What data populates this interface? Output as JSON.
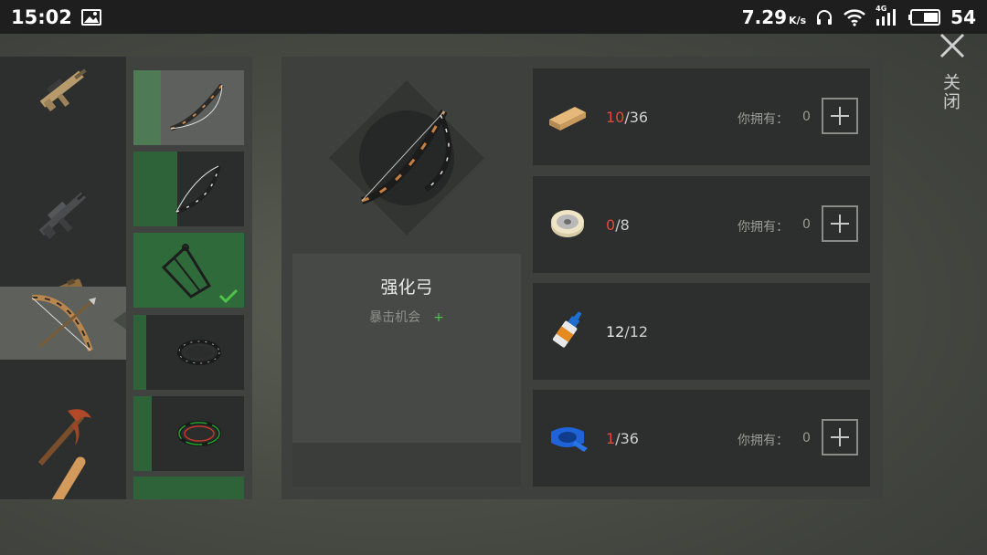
{
  "status_bar": {
    "time": "15:02",
    "net_speed": "7.29",
    "net_speed_unit": "K/s",
    "network_type": "4G",
    "battery": "54",
    "icons": [
      "gallery-icon",
      "headphones-icon",
      "wifi-icon",
      "signal-icon",
      "battery-icon"
    ]
  },
  "close": {
    "label": "关闭",
    "icon": "close-icon"
  },
  "categories": [
    {
      "id": "assault-rifle-1",
      "icon": "assault-rifle-icon",
      "selected": false
    },
    {
      "id": "assault-rifle-2",
      "icon": "rifle-icon",
      "selected": false
    },
    {
      "id": "pistol",
      "icon": "pistol-icon",
      "selected": false
    },
    {
      "id": "bow",
      "icon": "bow-icon",
      "selected": true
    },
    {
      "id": "pickaxe",
      "icon": "pickaxe-icon",
      "selected": false
    },
    {
      "id": "bat",
      "icon": "bat-icon",
      "selected": false
    }
  ],
  "variants": [
    {
      "id": "bow-1",
      "icon": "bow-icon",
      "crafted": false
    },
    {
      "id": "bow-2",
      "icon": "bow-icon",
      "crafted": false
    },
    {
      "id": "bow-3",
      "icon": "compound-bow-icon",
      "crafted": true
    },
    {
      "id": "bowstring-1",
      "icon": "bowstring-icon",
      "crafted": false
    },
    {
      "id": "bowstring-2",
      "icon": "bowstring-green-icon",
      "crafted": false
    },
    {
      "id": "variant-6",
      "icon": "",
      "crafted": false
    }
  ],
  "item": {
    "name": "强化弓",
    "attribute": "暴击机会",
    "attribute_plus": "+",
    "icon": "bow-icon"
  },
  "materials": [
    {
      "icon": "wood-plank-icon",
      "have": "10",
      "need": "/36",
      "enough": false,
      "own_label": "你拥有：",
      "own_value": "0",
      "show_add": true
    },
    {
      "icon": "wire-spool-icon",
      "have": "0",
      "need": "/8",
      "enough": false,
      "own_label": "你拥有：",
      "own_value": "0",
      "show_add": true
    },
    {
      "icon": "glue-icon",
      "have": "12",
      "need": "/12",
      "enough": true,
      "own_label": "",
      "own_value": "",
      "show_add": false
    },
    {
      "icon": "duct-tape-icon",
      "have": "1",
      "need": "/36",
      "enough": false,
      "own_label": "你拥有：",
      "own_value": "0",
      "show_add": true
    }
  ],
  "colors": {
    "insufficient": "#e04a3c",
    "crafted_accent": "#2e6238",
    "check": "#4ec24a"
  }
}
